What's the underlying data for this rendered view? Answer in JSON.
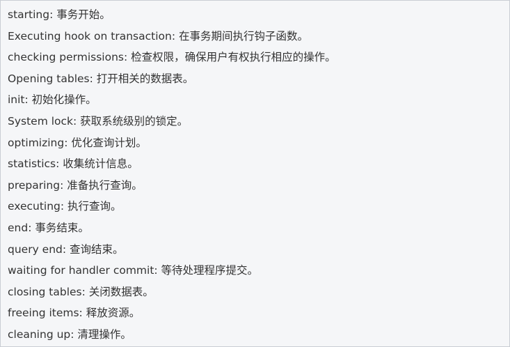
{
  "lines": [
    "starting: 事务开始。",
    "Executing hook on transaction: 在事务期间执行钩子函数。",
    "checking permissions: 检查权限，确保用户有权执行相应的操作。",
    "Opening tables: 打开相关的数据表。",
    "init: 初始化操作。",
    "System lock: 获取系统级别的锁定。",
    "optimizing: 优化查询计划。",
    "statistics: 收集统计信息。",
    "preparing: 准备执行查询。",
    "executing: 执行查询。",
    "end: 事务结束。",
    "query end: 查询结束。",
    "waiting for handler commit: 等待处理程序提交。",
    "closing tables: 关闭数据表。",
    "freeing items: 释放资源。",
    "cleaning up: 清理操作。"
  ]
}
